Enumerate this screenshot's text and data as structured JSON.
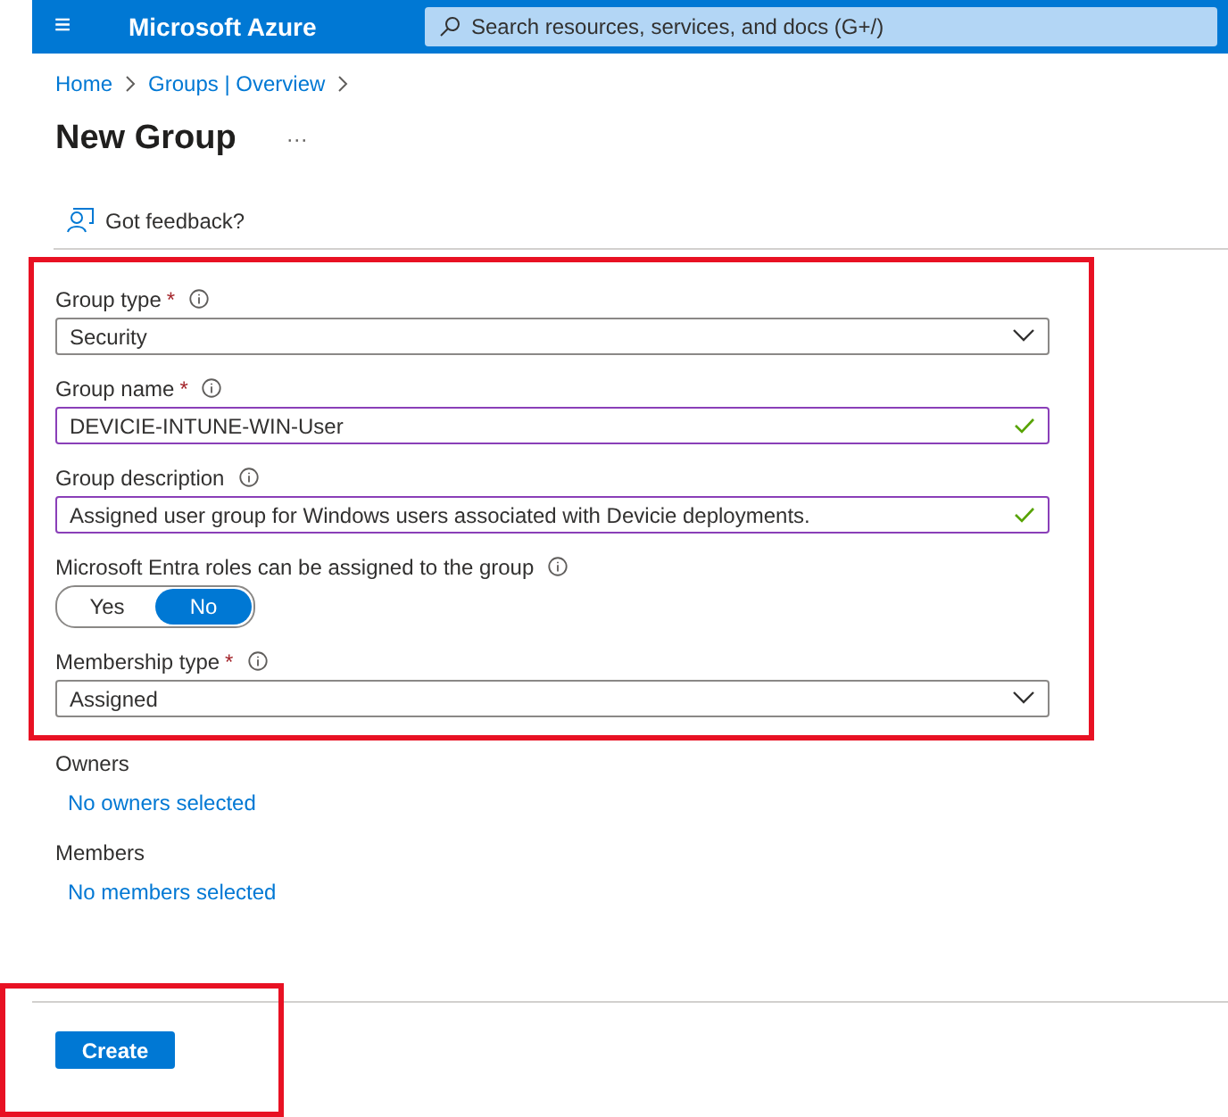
{
  "header": {
    "menu_icon": "≡",
    "brand": "Microsoft Azure",
    "search": {
      "placeholder": "Search resources, services, and docs (G+/)"
    }
  },
  "breadcrumb": [
    "Home",
    "Groups | Overview"
  ],
  "page": {
    "title": "New Group",
    "more": "···"
  },
  "toolbar": {
    "feedback": "Got feedback?"
  },
  "form": {
    "highlighted": true,
    "fields": [
      {
        "kind": "select",
        "label": "Group type",
        "required_mark": "*",
        "value": "Security",
        "valid": false
      },
      {
        "kind": "text",
        "label": "Group name",
        "required_mark": "*",
        "value": "DEVICIE-INTUNE-WIN-User",
        "valid": true
      },
      {
        "kind": "text",
        "label": "Group description",
        "value": "Assigned user group for Windows users associated with Devicie deployments.",
        "valid": true
      },
      {
        "kind": "toggle",
        "label": "Microsoft Entra roles can be assigned to the group",
        "options": [
          {
            "label": "Yes",
            "selected": false
          },
          {
            "label": "No",
            "selected": true
          }
        ]
      },
      {
        "kind": "select",
        "label": "Membership type",
        "required_mark": "*",
        "value": "Assigned",
        "valid": false
      }
    ],
    "pickers": [
      {
        "label": "Owners",
        "link": "No owners selected"
      },
      {
        "label": "Members",
        "link": "No members selected"
      }
    ]
  },
  "footer": {
    "create": "Create",
    "highlighted": true
  }
}
